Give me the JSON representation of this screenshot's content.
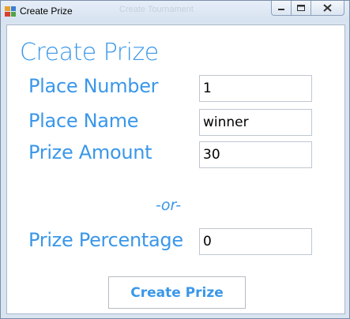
{
  "window": {
    "title": "Create Prize",
    "background_title": "Create Tournament",
    "icon": "form-icon"
  },
  "caption_buttons": {
    "minimize_icon": "minimize-icon",
    "maximize_icon": "maximize-icon",
    "close_icon": "close-icon"
  },
  "form": {
    "heading": "Create Prize",
    "place_number": {
      "label": "Place Number",
      "value": "1"
    },
    "place_name": {
      "label": "Place Name",
      "value": "winner"
    },
    "prize_amount": {
      "label": "Prize Amount",
      "value": "30"
    },
    "or_text": "-or-",
    "prize_percentage": {
      "label": "Prize Percentage",
      "value": "0"
    },
    "create_button": "Create Prize"
  },
  "colors": {
    "accent": "#3a97e9",
    "window_frame": "#d9e4f1",
    "field_border": "#bfc7d1"
  }
}
